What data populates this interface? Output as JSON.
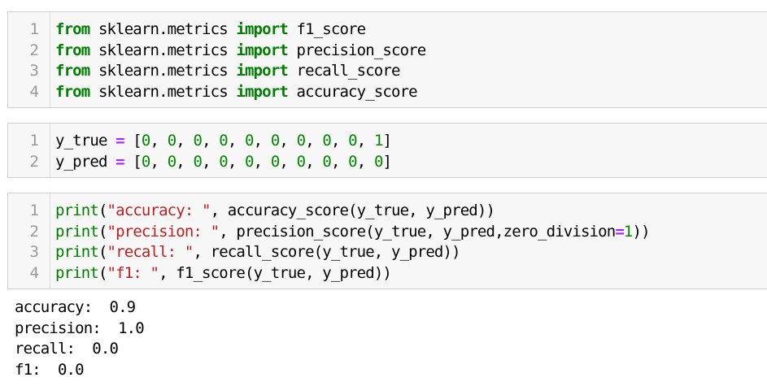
{
  "cells": [
    {
      "lines": [
        {
          "num": "1",
          "tokens": [
            {
              "t": "from",
              "c": "kw"
            },
            {
              "t": " sklearn.metrics ",
              "c": ""
            },
            {
              "t": "import",
              "c": "kw"
            },
            {
              "t": " f1_score",
              "c": ""
            }
          ]
        },
        {
          "num": "2",
          "tokens": [
            {
              "t": "from",
              "c": "kw"
            },
            {
              "t": " sklearn.metrics ",
              "c": ""
            },
            {
              "t": "import",
              "c": "kw"
            },
            {
              "t": " precision_score",
              "c": ""
            }
          ]
        },
        {
          "num": "3",
          "tokens": [
            {
              "t": "from",
              "c": "kw"
            },
            {
              "t": " sklearn.metrics ",
              "c": ""
            },
            {
              "t": "import",
              "c": "kw"
            },
            {
              "t": " recall_score",
              "c": ""
            }
          ]
        },
        {
          "num": "4",
          "tokens": [
            {
              "t": "from",
              "c": "kw"
            },
            {
              "t": " sklearn.metrics ",
              "c": ""
            },
            {
              "t": "import",
              "c": "kw"
            },
            {
              "t": " accuracy_score",
              "c": ""
            }
          ]
        }
      ]
    },
    {
      "lines": [
        {
          "num": "1",
          "tokens": [
            {
              "t": "y_true ",
              "c": ""
            },
            {
              "t": "=",
              "c": "op"
            },
            {
              "t": " [",
              "c": ""
            },
            {
              "t": "0",
              "c": "num"
            },
            {
              "t": ", ",
              "c": ""
            },
            {
              "t": "0",
              "c": "num"
            },
            {
              "t": ", ",
              "c": ""
            },
            {
              "t": "0",
              "c": "num"
            },
            {
              "t": ", ",
              "c": ""
            },
            {
              "t": "0",
              "c": "num"
            },
            {
              "t": ", ",
              "c": ""
            },
            {
              "t": "0",
              "c": "num"
            },
            {
              "t": ", ",
              "c": ""
            },
            {
              "t": "0",
              "c": "num"
            },
            {
              "t": ", ",
              "c": ""
            },
            {
              "t": "0",
              "c": "num"
            },
            {
              "t": ", ",
              "c": ""
            },
            {
              "t": "0",
              "c": "num"
            },
            {
              "t": ", ",
              "c": ""
            },
            {
              "t": "0",
              "c": "num"
            },
            {
              "t": ", ",
              "c": ""
            },
            {
              "t": "1",
              "c": "num"
            },
            {
              "t": "]",
              "c": ""
            }
          ]
        },
        {
          "num": "2",
          "tokens": [
            {
              "t": "y_pred ",
              "c": ""
            },
            {
              "t": "=",
              "c": "op"
            },
            {
              "t": " [",
              "c": ""
            },
            {
              "t": "0",
              "c": "num"
            },
            {
              "t": ", ",
              "c": ""
            },
            {
              "t": "0",
              "c": "num"
            },
            {
              "t": ", ",
              "c": ""
            },
            {
              "t": "0",
              "c": "num"
            },
            {
              "t": ", ",
              "c": ""
            },
            {
              "t": "0",
              "c": "num"
            },
            {
              "t": ", ",
              "c": ""
            },
            {
              "t": "0",
              "c": "num"
            },
            {
              "t": ", ",
              "c": ""
            },
            {
              "t": "0",
              "c": "num"
            },
            {
              "t": ", ",
              "c": ""
            },
            {
              "t": "0",
              "c": "num"
            },
            {
              "t": ", ",
              "c": ""
            },
            {
              "t": "0",
              "c": "num"
            },
            {
              "t": ", ",
              "c": ""
            },
            {
              "t": "0",
              "c": "num"
            },
            {
              "t": ", ",
              "c": ""
            },
            {
              "t": "0",
              "c": "num"
            },
            {
              "t": "]",
              "c": ""
            }
          ]
        }
      ]
    },
    {
      "lines": [
        {
          "num": "1",
          "tokens": [
            {
              "t": "print",
              "c": "bi"
            },
            {
              "t": "(",
              "c": ""
            },
            {
              "t": "\"accuracy: \"",
              "c": "str"
            },
            {
              "t": ", accuracy_score(y_true, y_pred))",
              "c": ""
            }
          ]
        },
        {
          "num": "2",
          "tokens": [
            {
              "t": "print",
              "c": "bi"
            },
            {
              "t": "(",
              "c": ""
            },
            {
              "t": "\"precision: \"",
              "c": "str"
            },
            {
              "t": ", precision_score(y_true, y_pred,zero_division",
              "c": ""
            },
            {
              "t": "=",
              "c": "op"
            },
            {
              "t": "1",
              "c": "num"
            },
            {
              "t": "))",
              "c": ""
            }
          ]
        },
        {
          "num": "3",
          "tokens": [
            {
              "t": "print",
              "c": "bi"
            },
            {
              "t": "(",
              "c": ""
            },
            {
              "t": "\"recall: \"",
              "c": "str"
            },
            {
              "t": ", recall_score(y_true, y_pred))",
              "c": ""
            }
          ]
        },
        {
          "num": "4",
          "tokens": [
            {
              "t": "print",
              "c": "bi"
            },
            {
              "t": "(",
              "c": ""
            },
            {
              "t": "\"f1: \"",
              "c": "str"
            },
            {
              "t": ", f1_score(y_true, y_pred))",
              "c": ""
            }
          ]
        }
      ]
    }
  ],
  "output": [
    "accuracy:  0.9",
    "precision:  1.0",
    "recall:  0.0",
    "f1:  0.0"
  ]
}
